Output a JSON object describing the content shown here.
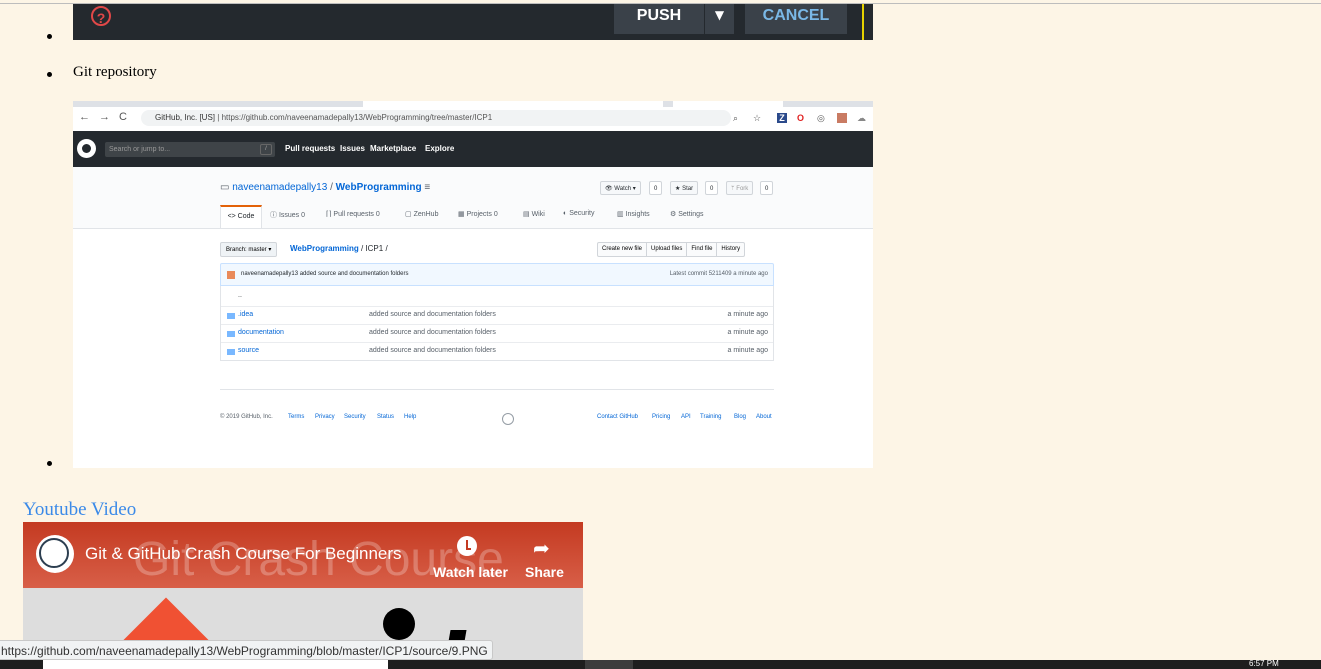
{
  "top_strip": {
    "help_glyph": "?",
    "push_label": "PUSH",
    "caret_glyph": "▼",
    "cancel_label": "CANCEL"
  },
  "list": {
    "item2_label": "Git repository"
  },
  "github_shot": {
    "address": {
      "site_label": "GitHub, Inc. [US]",
      "url": "https://github.com/naveenamadepally13/WebProgramming/tree/master/ICP1"
    },
    "header": {
      "search_placeholder": "Search or jump to...",
      "slash": "/",
      "nav": [
        "Pull requests",
        "Issues",
        "Marketplace",
        "Explore"
      ]
    },
    "repo": {
      "owner": "naveenamadepally13",
      "separator": "/",
      "name": "WebProgramming",
      "watch_label": "Watch ▾",
      "watch_count": "0",
      "star_label": "Star",
      "star_count": "0",
      "fork_label": "Fork",
      "fork_count": "0"
    },
    "tabs": {
      "code": "<> Code",
      "issues": "Issues",
      "issues_count": "0",
      "pulls": "Pull requests",
      "pulls_count": "0",
      "zenhub": "ZenHub",
      "projects": "Projects",
      "projects_count": "0",
      "wiki": "Wiki",
      "security": "Security",
      "insights": "Insights",
      "settings": "Settings"
    },
    "branch_label": "Branch: master ▾",
    "crumb_repo": "WebProgramming",
    "crumb_rest": "/ ICP1 /",
    "file_buttons": [
      "Create new file",
      "Upload files",
      "Find file",
      "History"
    ],
    "commit": {
      "author_message": "naveenamadepally13 added source and documentation folders",
      "latest": "Latest commit 5211409 a minute ago"
    },
    "up_dir": "..",
    "files": [
      {
        "name": ".idea",
        "message": "added source and documentation folders",
        "age": "a minute ago"
      },
      {
        "name": "documentation",
        "message": "added source and documentation folders",
        "age": "a minute ago"
      },
      {
        "name": "source",
        "message": "added source and documentation folders",
        "age": "a minute ago"
      }
    ],
    "footer": {
      "copyright": "© 2019 GitHub, Inc.",
      "left_links": [
        "Terms",
        "Privacy",
        "Security",
        "Status",
        "Help"
      ],
      "right_links": [
        "Contact GitHub",
        "Pricing",
        "API",
        "Training",
        "Blog",
        "About"
      ]
    }
  },
  "youtube": {
    "link_text": "Youtube Video",
    "video_title": "Git & GitHub Crash Course For Beginners",
    "ghost_text": "Git Crash Course",
    "watch_later": "Watch later",
    "share": "Share"
  },
  "status_bar_url": "https://github.com/naveenamadepally13/WebProgramming/blob/master/ICP1/source/9.PNG",
  "taskbar_clock": "6:57 PM",
  "colors": {
    "page_bg": "#fdf5e6",
    "link_blue": "#3b8ae8",
    "github_dark": "#24292e",
    "youtube_red": "#c43a21"
  }
}
